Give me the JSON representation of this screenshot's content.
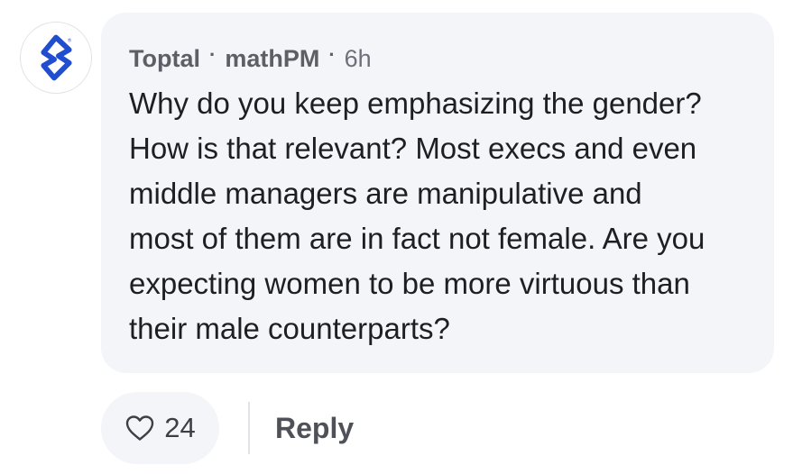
{
  "comment": {
    "author_org": "Toptal",
    "author_name": "mathPM",
    "separator": "·",
    "time_ago": "6h",
    "text": "Why do you keep emphasizing the gender?\nHow is that relevant? Most execs and even\nmiddle managers are manipulative and\nmost of them are in fact not female. Are you\nexpecting women to be more virtuous than\ntheir male counterparts?",
    "avatar_icon": "toptal-logo-icon",
    "brand_color": "#204ecf"
  },
  "actions": {
    "like_icon": "heart-icon",
    "like_count": "24",
    "reply_label": "Reply"
  }
}
